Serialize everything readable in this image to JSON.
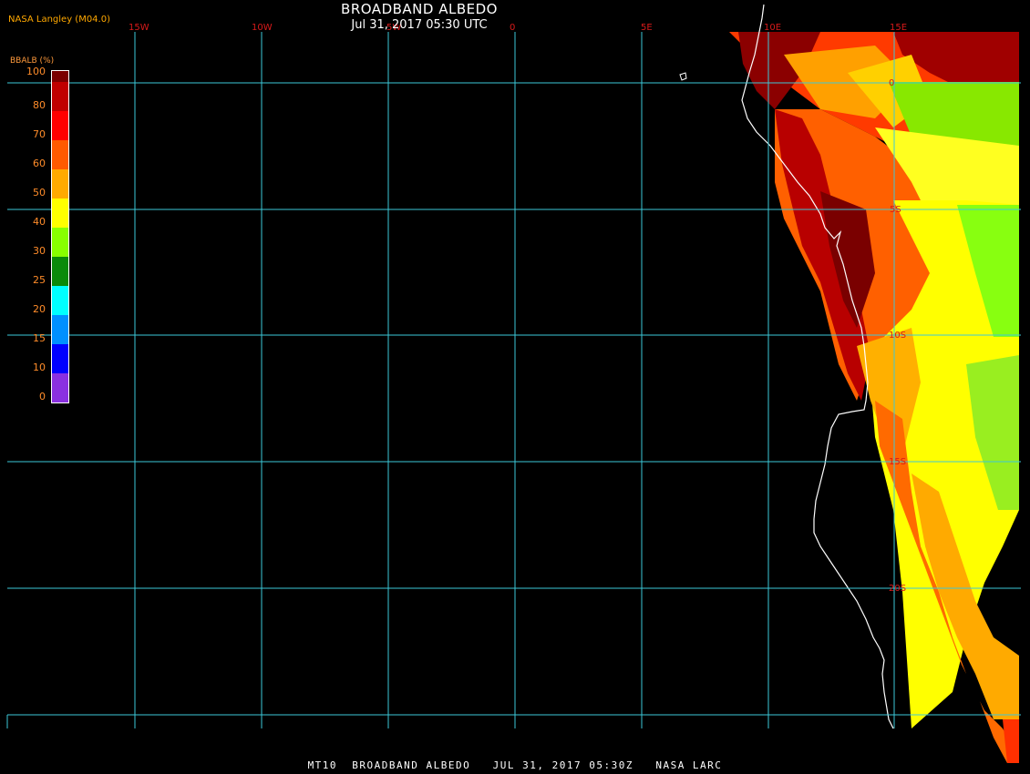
{
  "header": {
    "title": "BROADBAND ALBEDO",
    "subtitle": "Jul 31, 2017 05:30 UTC",
    "brand": "NASA Langley (M04.0)"
  },
  "legend": {
    "title": "BBALB (%)",
    "ticks": [
      "100",
      "80",
      "70",
      "60",
      "50",
      "40",
      "30",
      "25",
      "20",
      "15",
      "10",
      "0"
    ],
    "colors": [
      "#7a0000",
      "#c00000",
      "#ff0000",
      "#ff5a00",
      "#ffaa00",
      "#ffff00",
      "#88ff00",
      "#0a8a0a",
      "#00ffff",
      "#0090ff",
      "#0000ff",
      "#8a30e0"
    ]
  },
  "map": {
    "grid_color": "#3cc8d8",
    "coast_color": "#ffffff",
    "lon_labels": [
      "15W",
      "10W",
      "5W",
      "0",
      "5E",
      "10E",
      "15E"
    ],
    "lat_labels": [
      "0",
      "5S",
      "10S",
      "15S",
      "20S"
    ]
  },
  "footer": {
    "text": "MT10  BROADBAND ALBEDO   JUL 31, 2017 05:30Z   NASA LARC"
  }
}
